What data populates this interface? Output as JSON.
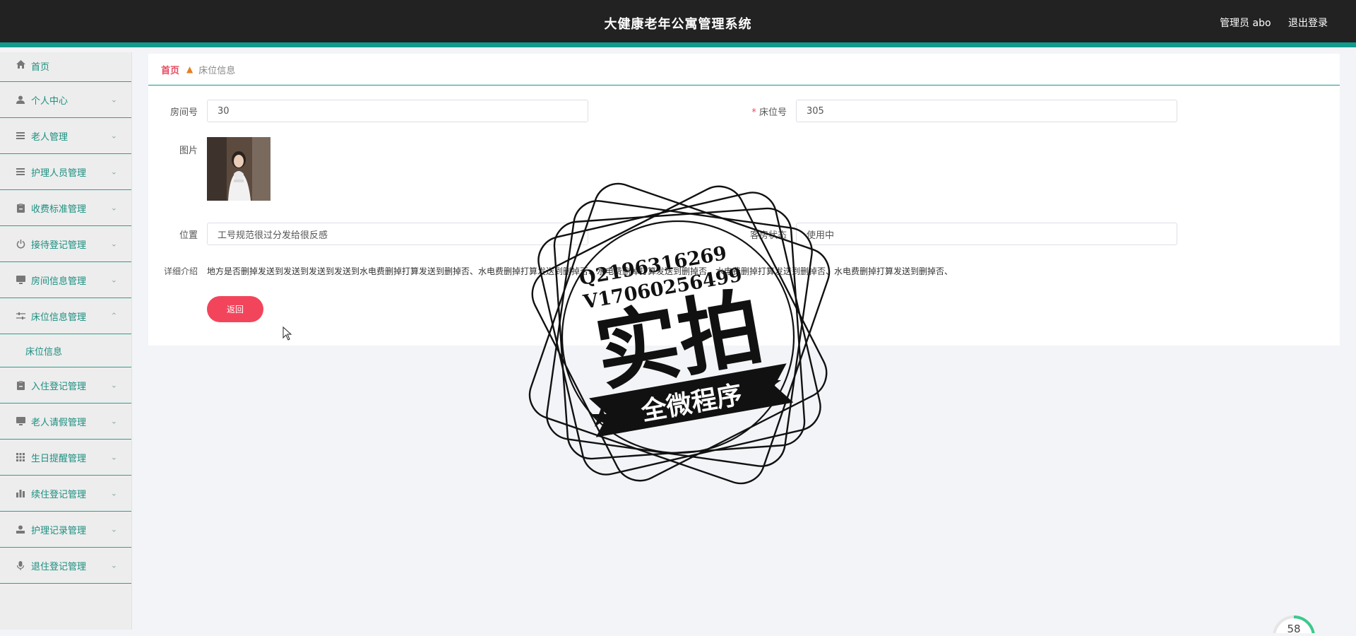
{
  "header": {
    "title": "大健康老年公寓管理系统",
    "user": "管理员 abo",
    "logout": "退出登录"
  },
  "sidebar": {
    "items": [
      {
        "label": "首页",
        "icon": "home-icon"
      },
      {
        "label": "个人中心",
        "icon": "user-icon"
      },
      {
        "label": "老人管理",
        "icon": "list-icon"
      },
      {
        "label": "护理人员管理",
        "icon": "list-icon"
      },
      {
        "label": "收费标准管理",
        "icon": "clipboard-icon"
      },
      {
        "label": "接待登记管理",
        "icon": "power-icon"
      },
      {
        "label": "房间信息管理",
        "icon": "monitor-icon"
      },
      {
        "label": "床位信息管理",
        "icon": "sliders-icon",
        "expanded": true
      },
      {
        "label": "入住登记管理",
        "icon": "clipboard-icon"
      },
      {
        "label": "老人请假管理",
        "icon": "monitor-icon"
      },
      {
        "label": "生日提醒管理",
        "icon": "grid-icon"
      },
      {
        "label": "续住登记管理",
        "icon": "bar-chart-icon"
      },
      {
        "label": "护理记录管理",
        "icon": "person-icon"
      },
      {
        "label": "退住登记管理",
        "icon": "mic-icon"
      }
    ],
    "submenu": {
      "label": "床位信息"
    }
  },
  "breadcrumb": {
    "home": "首页",
    "current": "床位信息"
  },
  "form": {
    "room_label": "房间号",
    "room_value": "30",
    "bed_required": "* ",
    "bed_label": "床位号",
    "bed_value": "305",
    "image_label": "图片",
    "location_label": "位置",
    "location_value": "工号规范很过分发给很反感",
    "status_label": "客房状态",
    "status_value": "使用中",
    "detail_label": "详细介绍",
    "detail_value": "地方是否删掉发送到发送到发送到发送到水电费删掉打算发送到删掉否、水电费删掉打算发送到删掉否、水电费删掉打算发送到删掉否、水电费删掉打算发送到删掉否、水电费删掉打算发送到删掉否、",
    "back_button": "返回"
  },
  "stamp": {
    "line1": "Q2196316269",
    "line2": "V17060256499",
    "main": "实拍",
    "banner": "全微程序"
  },
  "speed_widget": {
    "value": "58"
  },
  "colors": {
    "header_bg": "#222222",
    "accent": "#119b8d",
    "primary_button": "#f2455c",
    "breadcrumb_home": "#e84a5f"
  }
}
